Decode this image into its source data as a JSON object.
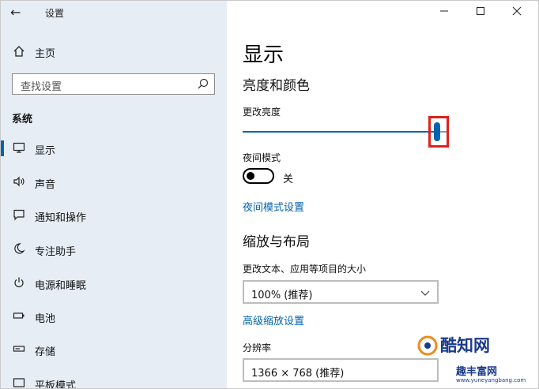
{
  "app": {
    "title": "设置"
  },
  "window_controls": {
    "minimize": "—",
    "maximize": "☐",
    "close": "✕"
  },
  "sidebar": {
    "home_label": "主页",
    "search_placeholder": "查找设置",
    "section_title": "系统",
    "items": [
      {
        "label": "显示",
        "icon": "monitor-icon",
        "active": true
      },
      {
        "label": "声音",
        "icon": "speaker-icon",
        "active": false
      },
      {
        "label": "通知和操作",
        "icon": "notification-icon",
        "active": false
      },
      {
        "label": "专注助手",
        "icon": "moon-icon",
        "active": false
      },
      {
        "label": "电源和睡眠",
        "icon": "power-icon",
        "active": false
      },
      {
        "label": "电池",
        "icon": "battery-icon",
        "active": false
      },
      {
        "label": "存储",
        "icon": "storage-icon",
        "active": false
      },
      {
        "label": "平板模式",
        "icon": "tablet-icon",
        "active": false
      }
    ]
  },
  "main": {
    "page_title": "显示",
    "brightness_section": "亮度和颜色",
    "brightness_label": "更改亮度",
    "brightness_value": 0.96,
    "night_mode_label": "夜间模式",
    "night_mode_state": "关",
    "night_mode_link": "夜间模式设置",
    "scale_section": "缩放与布局",
    "scale_label": "更改文本、应用等项目的大小",
    "scale_value": "100% (推荐)",
    "advanced_scale_link": "高级缩放设置",
    "resolution_label": "分辨率",
    "resolution_value": "1366 × 768 (推荐)"
  },
  "watermark": {
    "brand": "酷知网",
    "brand2": "趣丰富网",
    "url": "www.yuneyangbang.com"
  },
  "colors": {
    "accent": "#0063b1",
    "sidebar_bg": "#e6edf5",
    "highlight": "#e1201a"
  }
}
